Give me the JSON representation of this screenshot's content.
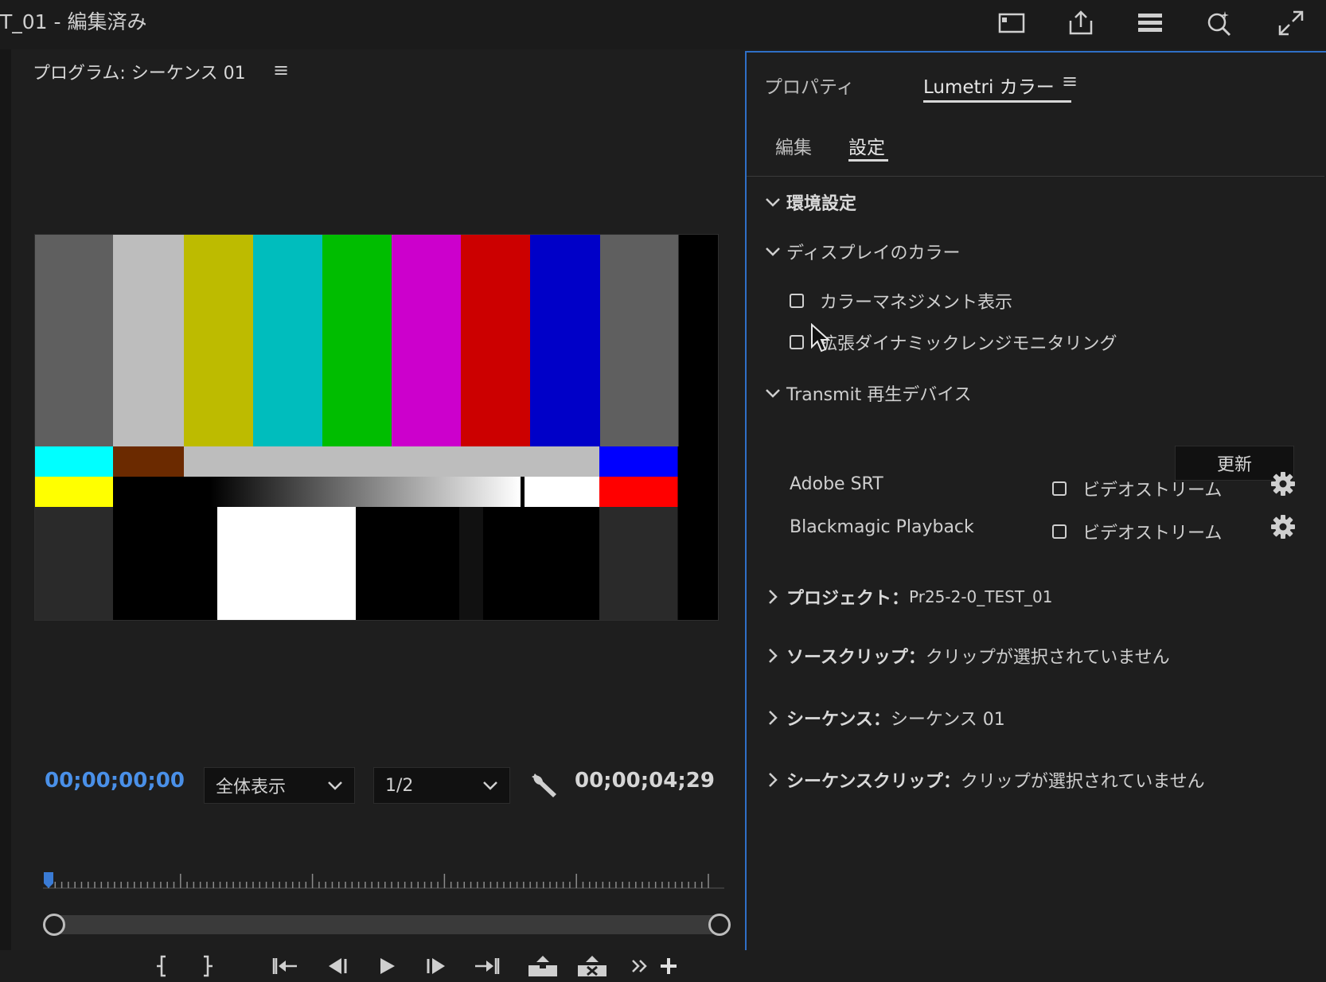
{
  "window": {
    "title": "T_01 - 編集済み"
  },
  "title_bar_icons": [
    "panel-layout-icon",
    "export-icon",
    "workspaces-icon",
    "search-help-icon",
    "fullscreen-icon"
  ],
  "program_monitor": {
    "title": "プログラム: シーケンス 01",
    "menu_glyph": "≡",
    "timecode_current": "00;00;00;00",
    "timecode_duration": "00;00;04;29",
    "zoom": {
      "selected": "全体表示"
    },
    "resolution": {
      "selected": "1/2"
    },
    "playhead_position": 0,
    "scroll_range": [
      0,
      1
    ],
    "colors": {
      "timecode_accent": "#4a90e8",
      "playhead": "#3a7bd5"
    },
    "color_bars": {
      "top": [
        "#5f5f5f",
        "#bdbdbd",
        "#bdbb00",
        "#00bdbd",
        "#00bd00",
        "#cc00cc",
        "#cc0000",
        "#0000c8",
        "#5f5f5f"
      ],
      "middle": [
        "#00ffff",
        "#6b2a00",
        "#bdbdbd",
        "#0000ff"
      ],
      "lower": [
        "#ffff00",
        "#000000",
        "#ffffff",
        "#ff0000"
      ],
      "pluge": [
        "#2a2a2a",
        "#000000",
        "#ffffff",
        "#000000",
        "#111111",
        "#000000",
        "#2a2a2a"
      ]
    },
    "transport_buttons": [
      "mark-in",
      "mark-out",
      "go-to-in",
      "step-back",
      "play",
      "step-forward",
      "go-to-out",
      "lift",
      "extract",
      "more-controls",
      "add-button"
    ]
  },
  "right_panel": {
    "tabs": {
      "properties": "プロパティ",
      "lumetri": "Lumetri カラー"
    },
    "menu_glyph": "≡",
    "subtabs": {
      "edit": "編集",
      "settings": "設定"
    },
    "preferences": {
      "label": "環境設定",
      "expanded": true
    },
    "display_color": {
      "label": "ディスプレイのカラー",
      "expanded": true,
      "color_management": {
        "label": "カラーマネジメント表示",
        "checked": false
      },
      "hdr_monitoring": {
        "label": "拡張ダイナミックレンジモニタリング",
        "checked": false
      }
    },
    "transmit": {
      "label": "Transmit 再生デバイス",
      "expanded": true,
      "update_label": "更新",
      "devices": [
        {
          "name": "Adobe SRT",
          "stream_label": "ビデオストリーム",
          "checked": false
        },
        {
          "name": "Blackmagic Playback",
          "stream_label": "ビデオストリーム",
          "checked": false
        }
      ]
    },
    "project": {
      "label": "プロジェクト：",
      "value": "Pr25-2-0_TEST_01"
    },
    "source_clip": {
      "label": "ソースクリップ：",
      "value": "クリップが選択されていません"
    },
    "sequence": {
      "label": "シーケンス：",
      "value": "シーケンス 01"
    },
    "sequence_clip": {
      "label": "シーケンスクリップ：",
      "value": "クリップが選択されていません"
    }
  }
}
